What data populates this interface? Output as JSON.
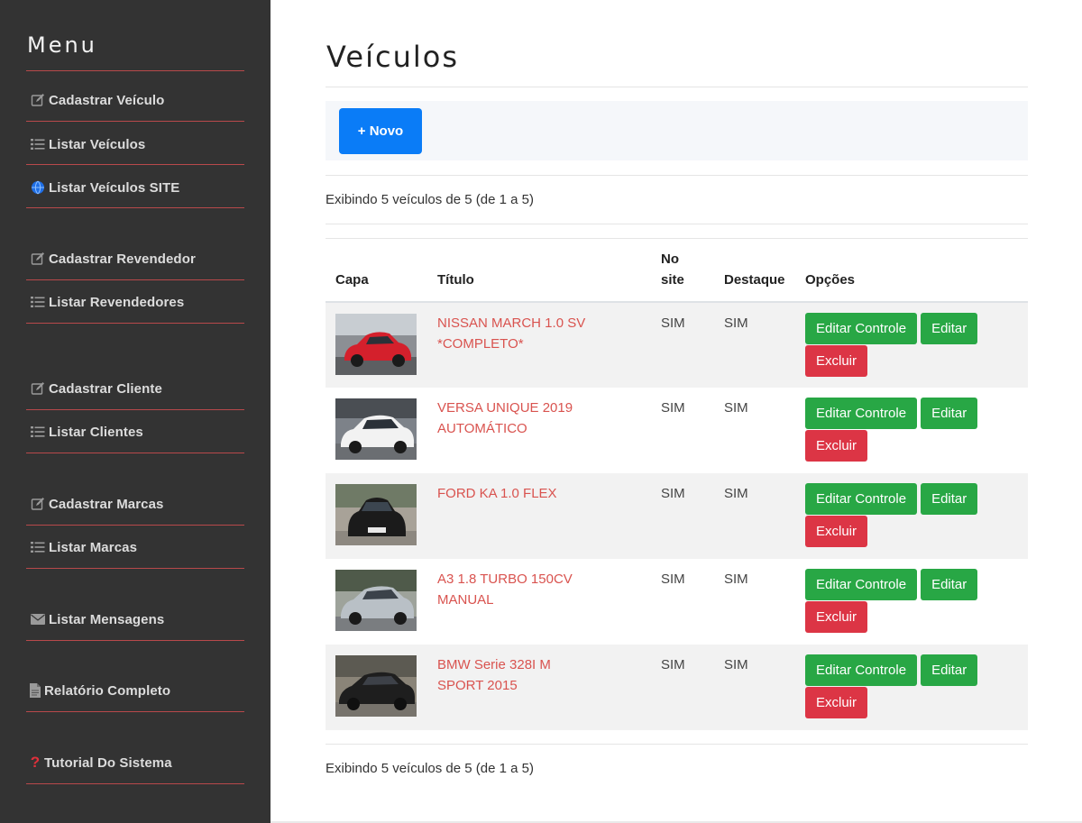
{
  "sidebar": {
    "title": "Menu",
    "items": [
      {
        "label": "Cadastrar Veículo",
        "icon": "edit-icon"
      },
      {
        "label": "Listar Veículos",
        "icon": "list-icon"
      },
      {
        "label": "Listar Veículos SITE",
        "icon": "globe-icon"
      },
      {
        "label": "Cadastrar Revendedor",
        "icon": "edit-icon"
      },
      {
        "label": "Listar Revendedores",
        "icon": "list-icon"
      },
      {
        "label": "Cadastrar Cliente",
        "icon": "edit-icon"
      },
      {
        "label": "Listar Clientes",
        "icon": "list-icon"
      },
      {
        "label": "Cadastrar Marcas",
        "icon": "edit-icon"
      },
      {
        "label": "Listar Marcas",
        "icon": "list-icon"
      },
      {
        "label": "Listar Mensagens",
        "icon": "envelope-icon"
      },
      {
        "label": "Relatório Completo",
        "icon": "file-icon"
      },
      {
        "label": "Tutorial Do Sistema",
        "icon": "question-icon"
      }
    ]
  },
  "main": {
    "title": "Veículos",
    "new_button": "+ Novo",
    "count_top": "Exibindo 5 veículos de 5 (de 1 a 5)",
    "count_bottom": "Exibindo 5 veículos de 5 (de 1 a 5)",
    "table": {
      "headers": {
        "capa": "Capa",
        "titulo": "Título",
        "no_site": "No site",
        "destaque": "Destaque",
        "opcoes": "Opções"
      },
      "buttons": {
        "edit_control": "Editar Controle",
        "edit": "Editar",
        "delete": "Excluir"
      },
      "rows": [
        {
          "title": "NISSAN MARCH 1.0 SV *COMPLETO*",
          "no_site": "SIM",
          "destaque": "SIM",
          "car_color": "#d4202c"
        },
        {
          "title": "VERSA UNIQUE 2019 AUTOMÁTICO",
          "no_site": "SIM",
          "destaque": "SIM",
          "car_color": "#f2f2f2"
        },
        {
          "title": "FORD KA 1.0 FLEX",
          "no_site": "SIM",
          "destaque": "SIM",
          "car_color": "#1b1b1b"
        },
        {
          "title": "A3 1.8 TURBO 150CV MANUAL",
          "no_site": "SIM",
          "destaque": "SIM",
          "car_color": "#b9c0c6"
        },
        {
          "title": "BMW Serie 328I M SPORT 2015",
          "no_site": "SIM",
          "destaque": "SIM",
          "car_color": "#1e1e1e"
        }
      ]
    }
  },
  "colors": {
    "sidebar_bg": "#333333",
    "sidebar_divider": "#b8494b",
    "primary": "#0a7cf7",
    "success": "#28a745",
    "danger": "#dc3545",
    "title_link": "#d9534f"
  }
}
